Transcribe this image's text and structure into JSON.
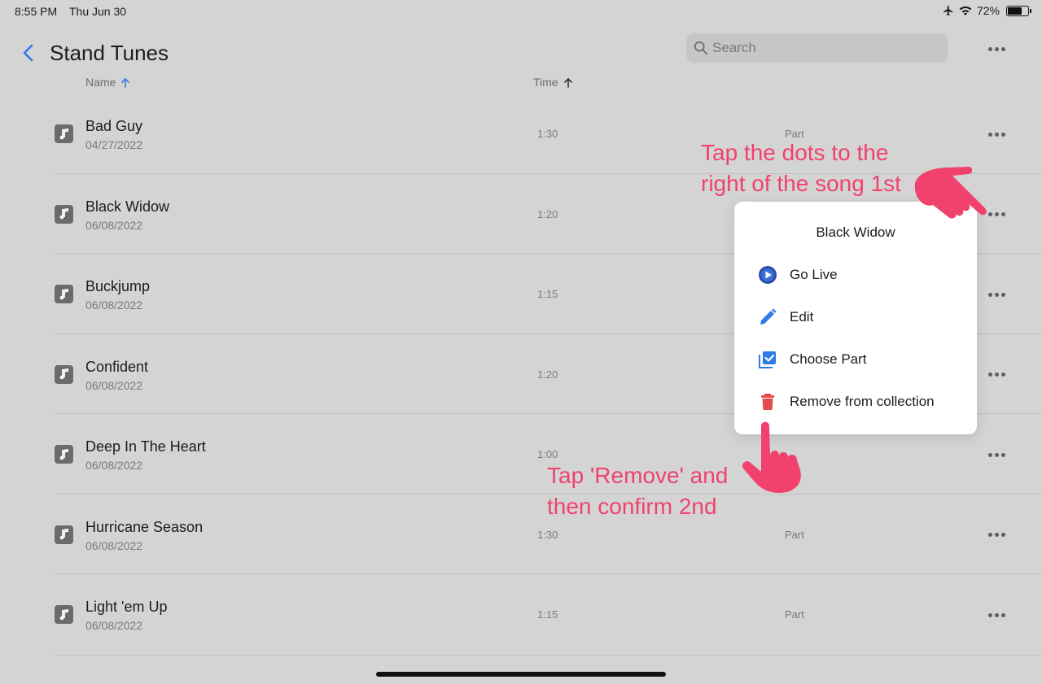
{
  "status": {
    "time": "8:55 PM",
    "date": "Thu Jun 30",
    "battery": "72%",
    "battery_level": 0.72
  },
  "header": {
    "title": "Stand Tunes",
    "search_placeholder": "Search"
  },
  "columns": {
    "name": "Name",
    "time": "Time"
  },
  "songs": [
    {
      "name": "Bad Guy",
      "date": "04/27/2022",
      "time": "1:30",
      "part": "Part"
    },
    {
      "name": "Black Widow",
      "date": "06/08/2022",
      "time": "1:20",
      "part": ""
    },
    {
      "name": "Buckjump",
      "date": "06/08/2022",
      "time": "1:15",
      "part": ""
    },
    {
      "name": "Confident",
      "date": "06/08/2022",
      "time": "1:20",
      "part": ""
    },
    {
      "name": "Deep In The Heart",
      "date": "06/08/2022",
      "time": "1:00",
      "part": ""
    },
    {
      "name": "Hurricane Season",
      "date": "06/08/2022",
      "time": "1:30",
      "part": "Part"
    },
    {
      "name": "Light 'em Up",
      "date": "06/08/2022",
      "time": "1:15",
      "part": "Part"
    }
  ],
  "context_menu": {
    "title": "Black Widow",
    "items": [
      {
        "label": "Go Live",
        "icon": "play-circle-icon"
      },
      {
        "label": "Edit",
        "icon": "pencil-icon"
      },
      {
        "label": "Choose Part",
        "icon": "checkbox-stack-icon"
      },
      {
        "label": "Remove from collection",
        "icon": "trash-icon"
      }
    ]
  },
  "annotations": {
    "step1": [
      "Tap the dots to the",
      "right of the song 1st"
    ],
    "step2": [
      "Tap 'Remove' and",
      "then confirm 2nd"
    ]
  },
  "colors": {
    "accent": "#2f7ae5",
    "annotation": "#f0426d",
    "delete": "#e5484d"
  }
}
